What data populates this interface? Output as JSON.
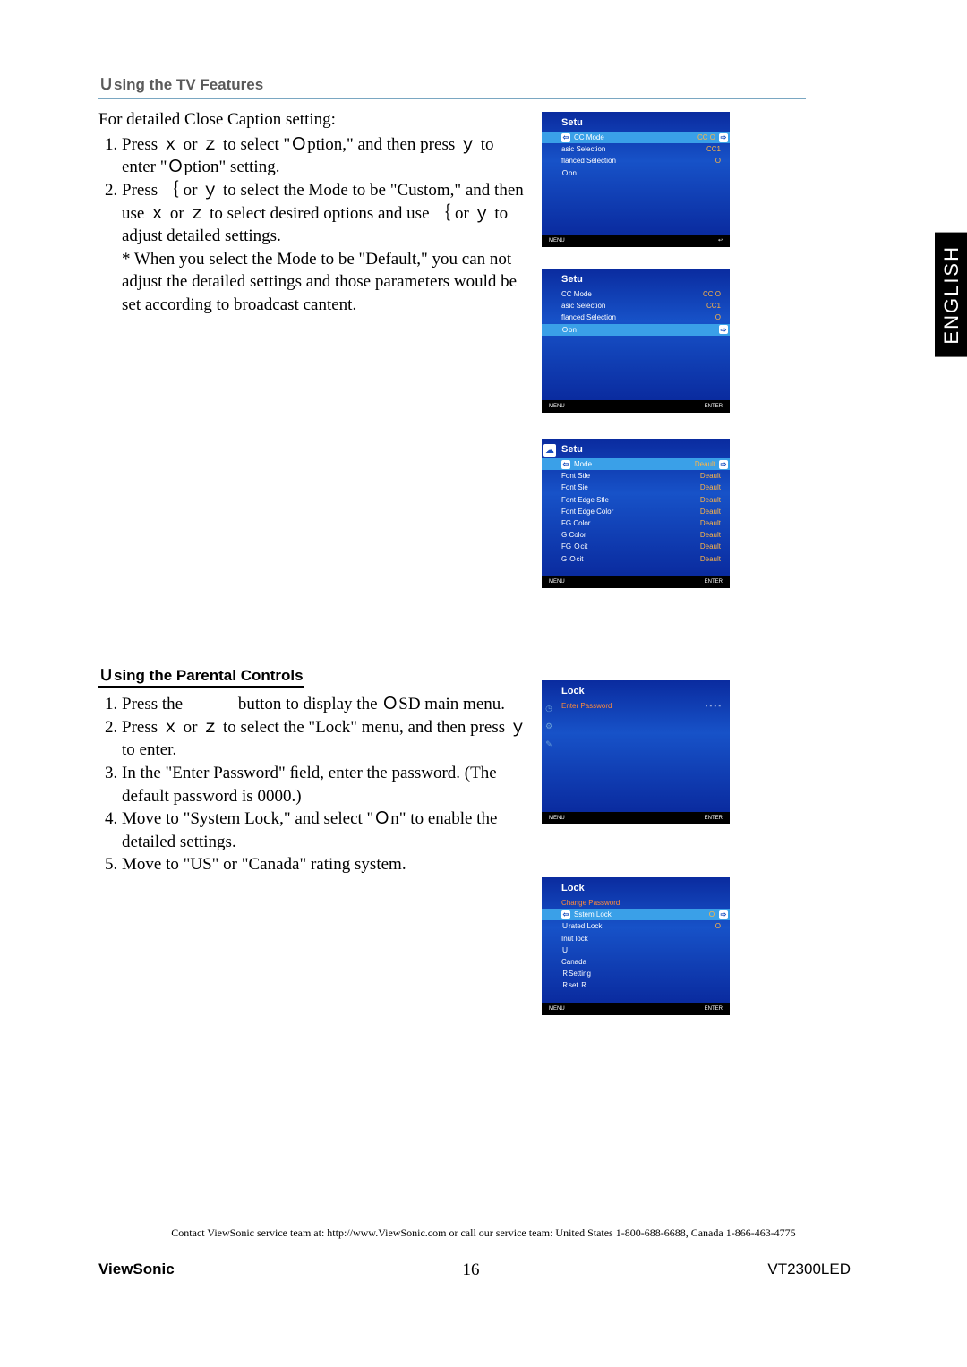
{
  "langTab": "ENGLISH",
  "heading1": "Ｕsing the TV Features",
  "cc_intro": "For detailed Close Caption setting:",
  "cc_steps": [
    "Press ｘ or ｚ to select \"Ｏption,\" and then press ｙ to enter \"Ｏption\" setting.",
    "Press ｛ or ｙ to select the Mode to be \"Custom,\" and then use ｘ or ｚ to select desired options and use ｛ or ｙ to adjust detailed settings."
  ],
  "cc_note": "* When you select the Mode to be \"Default,\" you can not adjust the detailed settings and those parameters would be set according to broadcast cantent.",
  "heading2": "Ｕsing the Parental Controls",
  "pc_steps": [
    "Press the             button to display the ＯSD main menu.",
    "Press ｘ or ｚ to select the \"Lock\" menu, and then press ｙ to enter.",
    "In the \"Enter Password\" ﬁeld, enter the password. (The default password is 0000.)",
    "Move to \"System Lock,\" and select \"Ｏn\" to enable the detailed settings.",
    "Move to \"US\" or \"Canada\" rating system."
  ],
  "osd1": {
    "title": "Setu",
    "rows": [
      {
        "k": "CC Mode",
        "v": "CC O",
        "hl": true
      },
      {
        "k": "asic Selection",
        "v": "CC1"
      },
      {
        "k": "ﬂanced Selection",
        "v": "O"
      },
      {
        "k": "Ｏon",
        "v": ""
      }
    ]
  },
  "osd2": {
    "title": "Setu",
    "rows": [
      {
        "k": "CC Mode",
        "v": "CC O"
      },
      {
        "k": "asic Selection",
        "v": "CC1"
      },
      {
        "k": "ﬂanced Selection",
        "v": "O"
      },
      {
        "k": "Ｏon",
        "v": "",
        "hl": true
      }
    ]
  },
  "osd3": {
    "title": "Setu",
    "rows": [
      {
        "k": "Mode",
        "v": "Deault",
        "hl": true
      },
      {
        "k": "Font Stle",
        "v": "Deault"
      },
      {
        "k": "Font Sie",
        "v": "Deault"
      },
      {
        "k": "Font Edge Stle",
        "v": "Deault"
      },
      {
        "k": "Font Edge Color",
        "v": "Deault"
      },
      {
        "k": "FG Color",
        "v": "Deault"
      },
      {
        "k": "G Color",
        "v": "Deault"
      },
      {
        "k": "FG Ｏcit",
        "v": "Deault"
      },
      {
        "k": "G Ｏcit",
        "v": "Deault"
      }
    ]
  },
  "osd4": {
    "title": "Lock",
    "rows": [
      {
        "k": "Enter Password",
        "v": "- - - -"
      }
    ]
  },
  "osd5": {
    "title": "Lock",
    "rows": [
      {
        "k": "Change Password",
        "v": ""
      },
      {
        "k": "Sstem Lock",
        "v": "Ｏ",
        "hl": true
      },
      {
        "k": "Ｕrated Lock",
        "v": "O"
      },
      {
        "k": "Inut lock",
        "v": ""
      },
      {
        "k": "Ｕ",
        "v": ""
      },
      {
        "k": "Canada",
        "v": ""
      },
      {
        "k": "ＲSetting",
        "v": ""
      },
      {
        "k": "Ｒset Ｒ",
        "v": ""
      }
    ]
  },
  "footer_menu": "MENU",
  "footer_enter": "ENTER",
  "contact": "Contact ViewSonic service team at: http://www.ViewSonic.com or call our service team: United States 1-800-688-6688, Canada 1-866-463-4775",
  "footer": {
    "brand": "ViewSonic",
    "page": "16",
    "model": "VT2300LED"
  }
}
